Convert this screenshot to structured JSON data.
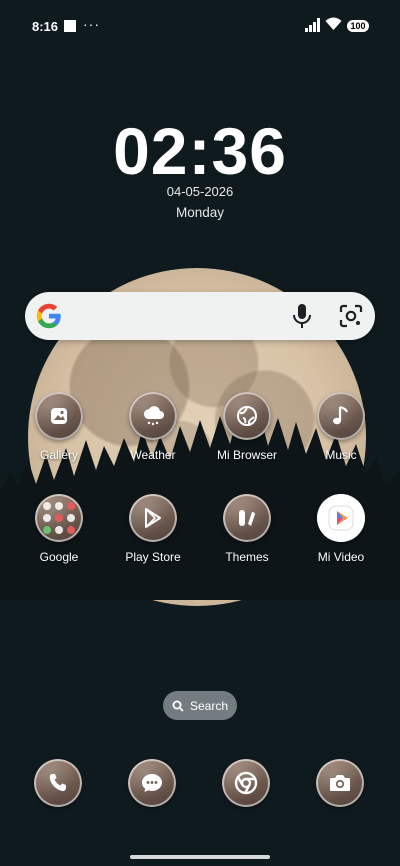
{
  "status_bar": {
    "time": "8:16",
    "more": "···",
    "battery": "100"
  },
  "clock": {
    "time": "02:36",
    "date": "04-05-2026",
    "day": "Monday"
  },
  "apps": [
    {
      "label": "Gallery",
      "icon": "gallery-icon"
    },
    {
      "label": "Weather",
      "icon": "weather-icon"
    },
    {
      "label": "Mi Browser",
      "icon": "browser-icon"
    },
    {
      "label": "Music",
      "icon": "music-icon"
    },
    {
      "label": "Google",
      "icon": "folder-icon"
    },
    {
      "label": "Play Store",
      "icon": "play-store-icon"
    },
    {
      "label": "Themes",
      "icon": "themes-icon"
    },
    {
      "label": "Mi Video",
      "icon": "mi-video-icon"
    }
  ],
  "app_search": {
    "label": "Search"
  },
  "dock": [
    {
      "icon": "phone-icon"
    },
    {
      "icon": "messages-icon"
    },
    {
      "icon": "chrome-icon"
    },
    {
      "icon": "camera-icon"
    }
  ],
  "colors": {
    "background": "#0f1a1f",
    "moon": "#d9c2a2",
    "icon_ring": "#ffffff"
  }
}
